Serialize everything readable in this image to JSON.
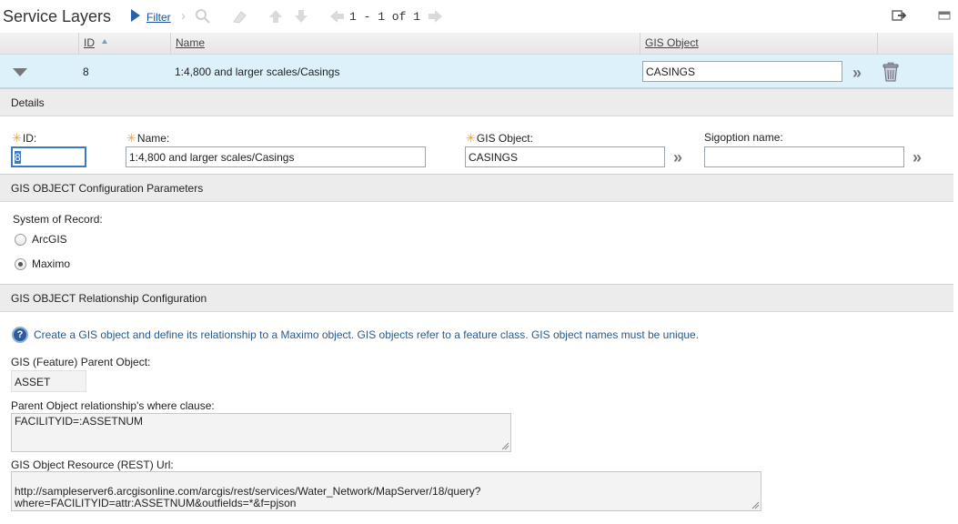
{
  "toolbar": {
    "title": "Service Layers",
    "filter_label": "Filter",
    "pager": "1 - 1 of 1"
  },
  "table": {
    "columns": [
      "ID",
      "Name",
      "GIS Object"
    ],
    "row": {
      "id": "8",
      "name": "1:4,800 and larger scales/Casings",
      "gis_object": "CASINGS"
    }
  },
  "details": {
    "header": "Details",
    "id_label": "ID:",
    "id_value": "8",
    "name_label": "Name:",
    "name_value": "1:4,800 and larger scales/Casings",
    "gis_object_label": "GIS Object:",
    "gis_object_value": "CASINGS",
    "sigoption_label": "Sigoption name:",
    "sigoption_value": ""
  },
  "config": {
    "header": "GIS OBJECT Configuration Parameters",
    "system_label": "System of Record:",
    "options": [
      {
        "label": "ArcGIS",
        "selected": false
      },
      {
        "label": "Maximo",
        "selected": true
      }
    ]
  },
  "relationship": {
    "header": "GIS OBJECT Relationship Configuration",
    "help_text": "Create a GIS object and define its relationship to a Maximo object. GIS objects refer to a feature class. GIS object names must be unique.",
    "parent_label": "GIS (Feature) Parent Object:",
    "parent_value": "ASSET",
    "where_label": "Parent Object relationship's where clause:",
    "where_value": "FACILITYID=:ASSETNUM",
    "url_label": "GIS Object Resource (REST) Url:",
    "url_value": "http://sampleserver6.arcgisonline.com/arcgis/rest/services/Water_Network/MapServer/18/query?\nwhere=FACILITYID=attr:ASSETNUM&outfields=*&f=pjson"
  },
  "colors": {
    "accent": "#2a62a8",
    "row_highlight": "#dcf1fa",
    "required": "#e8a33b",
    "help_text": "#2a5a8c"
  }
}
